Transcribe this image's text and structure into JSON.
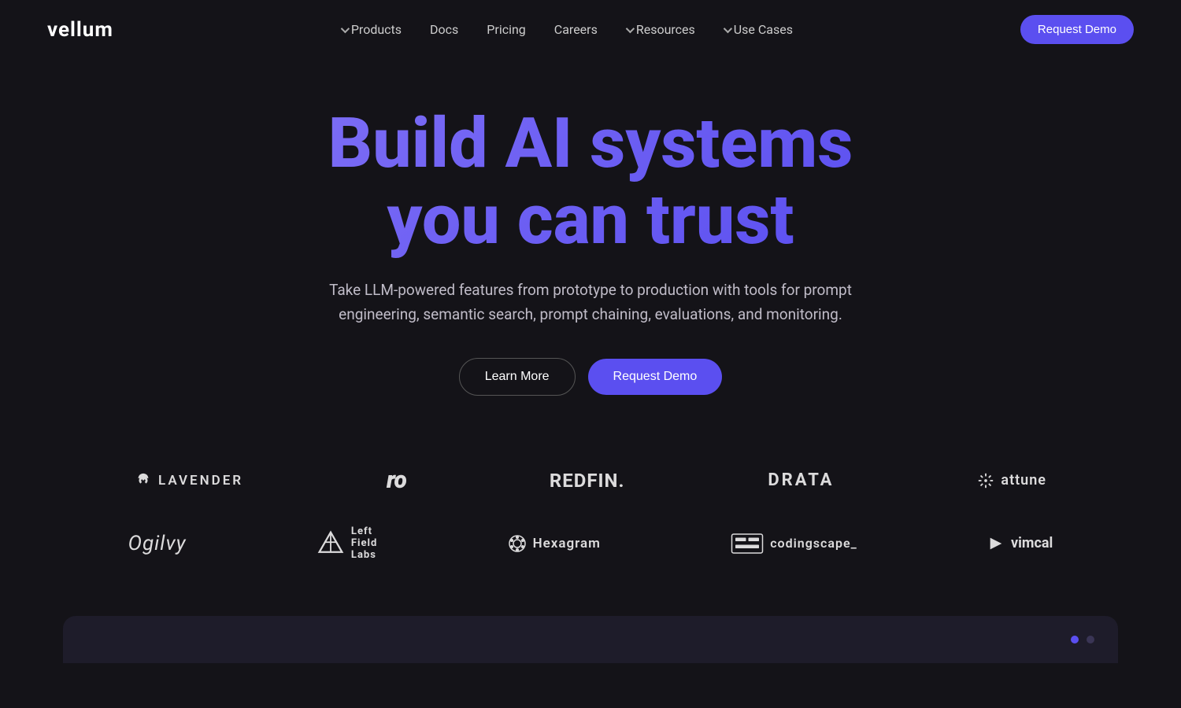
{
  "brand": {
    "name": "vellum"
  },
  "nav": {
    "links": [
      {
        "id": "products",
        "label": "Products",
        "hasDropdown": true
      },
      {
        "id": "docs",
        "label": "Docs",
        "hasDropdown": false
      },
      {
        "id": "pricing",
        "label": "Pricing",
        "hasDropdown": false
      },
      {
        "id": "careers",
        "label": "Careers",
        "hasDropdown": false
      },
      {
        "id": "resources",
        "label": "Resources",
        "hasDropdown": true
      },
      {
        "id": "use-cases",
        "label": "Use Cases",
        "hasDropdown": true
      }
    ],
    "cta_label": "Request Demo"
  },
  "hero": {
    "title_line1": "Build AI systems",
    "title_line2": "you can trust",
    "subtitle": "Take LLM-powered features from prototype to production with tools for prompt engineering, semantic search, prompt chaining, evaluations, and monitoring.",
    "btn_learn_more": "Learn More",
    "btn_request_demo": "Request Demo"
  },
  "logos": {
    "row1": [
      {
        "id": "lavender",
        "name": "LAVENDER"
      },
      {
        "id": "ro",
        "name": "ro"
      },
      {
        "id": "redfin",
        "name": "REDFIN."
      },
      {
        "id": "drata",
        "name": "DRATA"
      },
      {
        "id": "attune",
        "name": "attune"
      }
    ],
    "row2": [
      {
        "id": "ogilvy",
        "name": "Ogilvy"
      },
      {
        "id": "leftfield",
        "name": "Left Field Labs"
      },
      {
        "id": "hexagram",
        "name": "Hexagram"
      },
      {
        "id": "codingscape",
        "name": "codingscape_"
      },
      {
        "id": "vimcal",
        "name": "vimcal"
      }
    ]
  }
}
